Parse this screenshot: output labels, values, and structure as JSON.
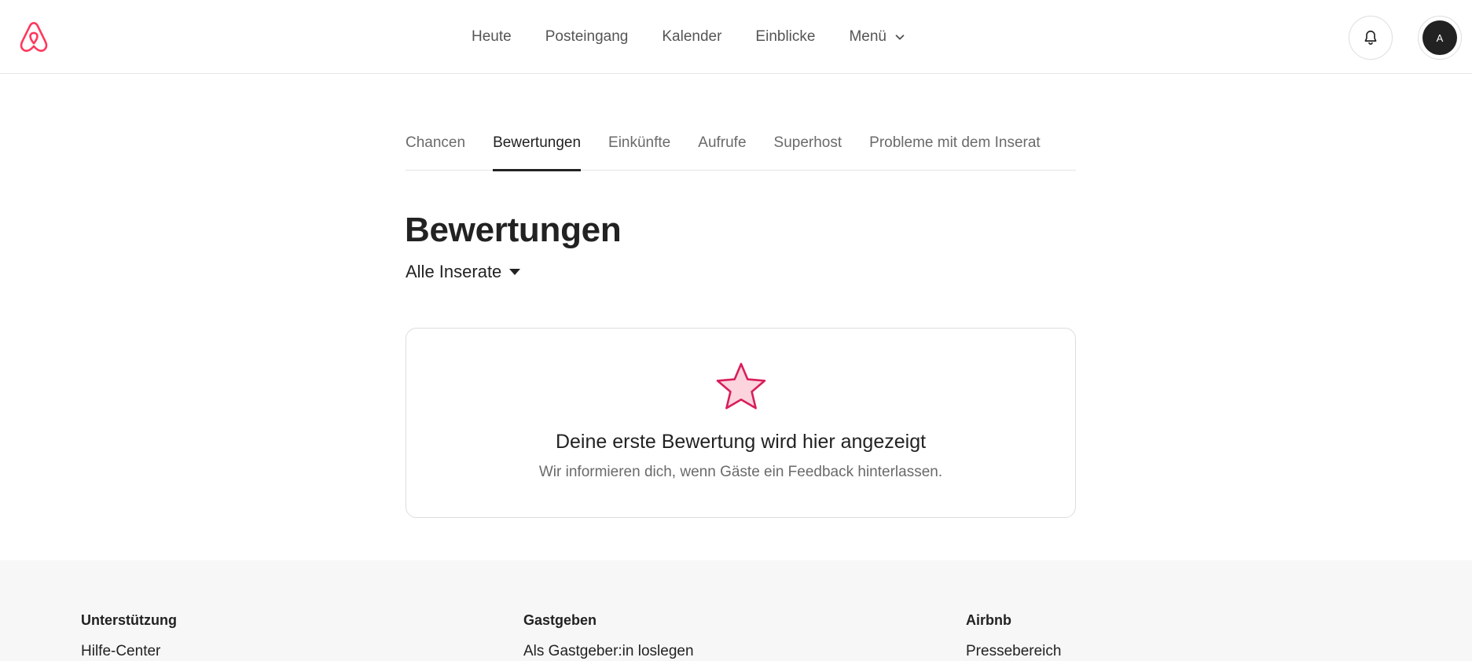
{
  "header": {
    "logo_icon": "airbnb-logo-icon",
    "brand_color": "#ff385c",
    "nav": [
      "Heute",
      "Posteingang",
      "Kalender",
      "Einblicke",
      "Menü"
    ],
    "bell_icon": "bell-icon",
    "avatar_initial": "A"
  },
  "subtabs": {
    "items": [
      "Chancen",
      "Bewertungen",
      "Einkünfte",
      "Aufrufe",
      "Superhost",
      "Probleme mit dem Inserat"
    ],
    "active": "Bewertungen"
  },
  "main": {
    "title": "Bewertungen",
    "filter_label": "Alle Inserate",
    "empty_state": {
      "icon": "star-icon",
      "title": "Deine erste Bewertung wird hier angezeigt",
      "subtitle": "Wir informieren dich, wenn Gäste ein Feedback hinterlassen."
    }
  },
  "footer": {
    "columns": [
      {
        "title": "Unterstützung",
        "links": [
          "Hilfe-Center"
        ]
      },
      {
        "title": "Gastgeben",
        "links": [
          "Als Gastgeber:in loslegen"
        ]
      },
      {
        "title": "Airbnb",
        "links": [
          "Pressebereich"
        ]
      }
    ]
  }
}
